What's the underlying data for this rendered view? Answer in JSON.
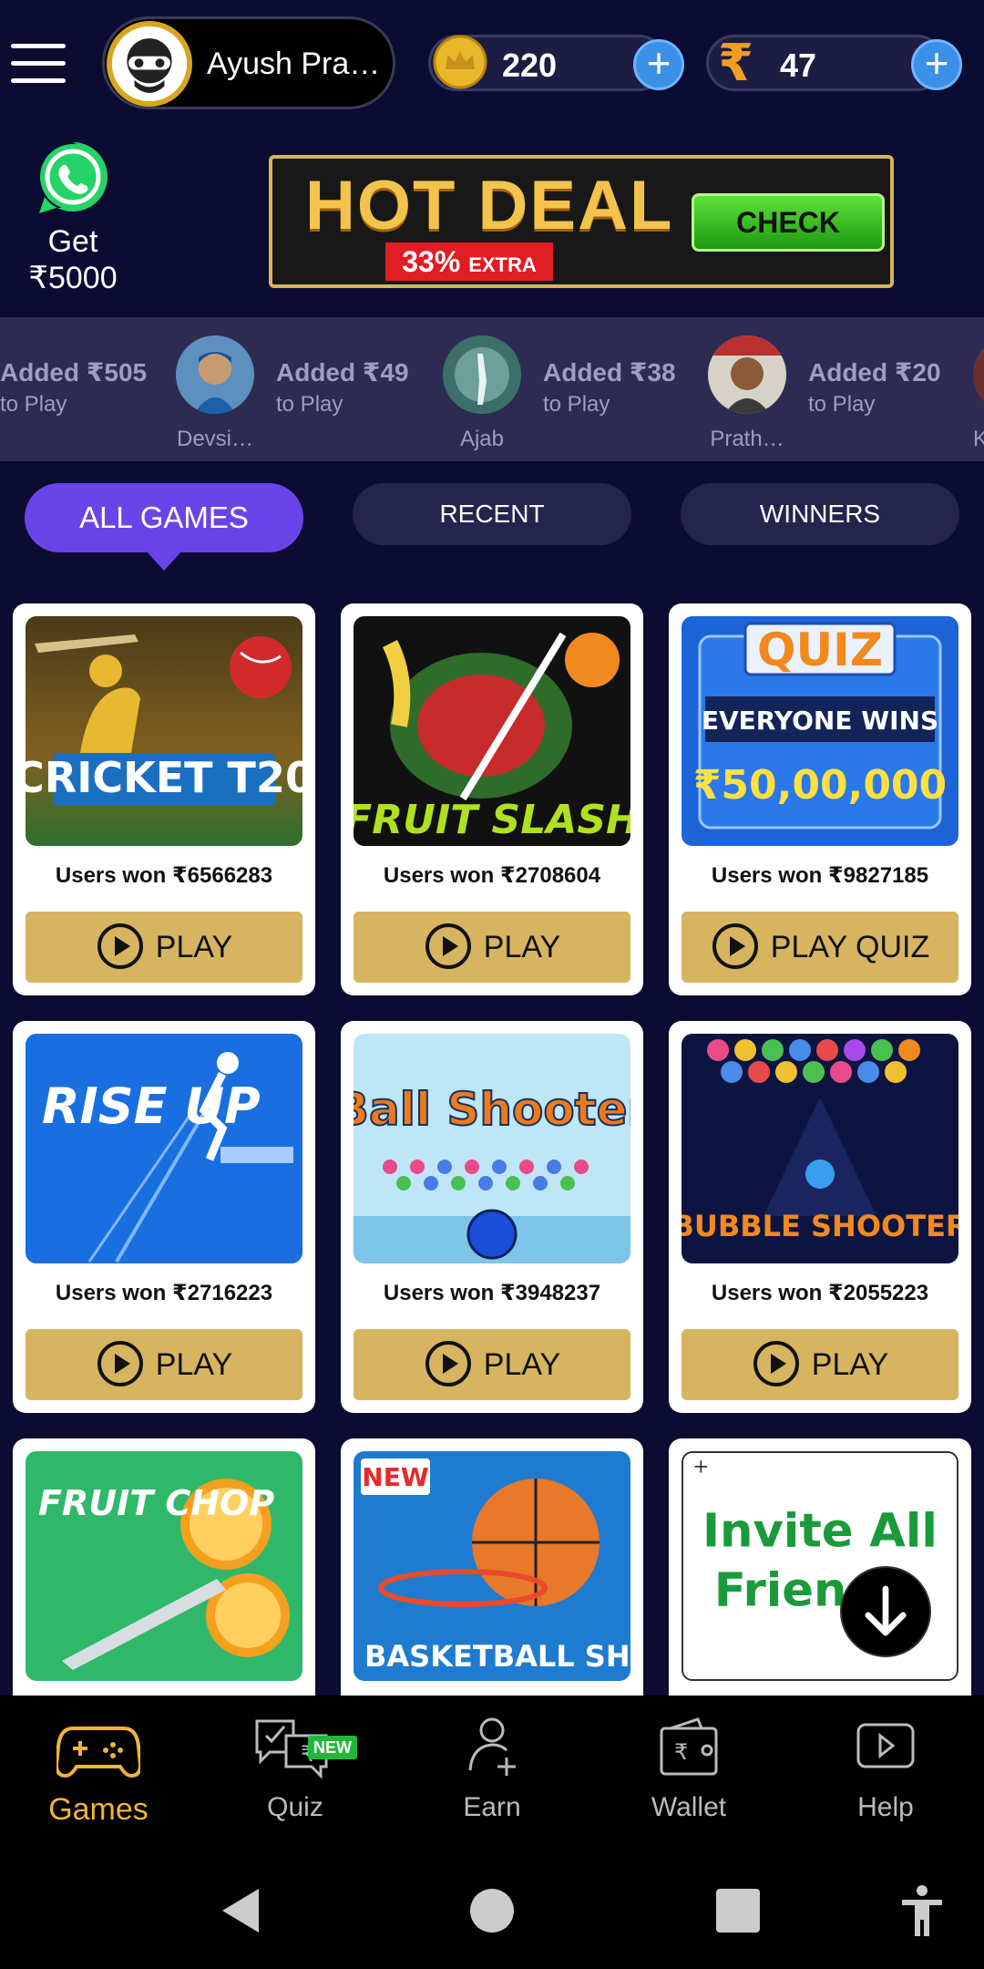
{
  "header": {
    "profile_name": "Ayush Pra…",
    "coins": "220",
    "cash": "47",
    "cash_symbol": "₹"
  },
  "promo": {
    "whatsapp_line1": "Get",
    "whatsapp_line2": "₹5000",
    "hot_deal_title": "HOT DEAL",
    "hot_deal_pct": "33%",
    "hot_deal_extra": "EXTRA",
    "check_label": "CHECK"
  },
  "ticker": [
    {
      "amount": "Added ₹505",
      "sub": "to Play",
      "name": ""
    },
    {
      "amount": "Added ₹49",
      "sub": "to Play",
      "name": "Devsi…"
    },
    {
      "amount": "Added ₹38",
      "sub": "to Play",
      "name": "Ajab"
    },
    {
      "amount": "Added ₹20",
      "sub": "to Play",
      "name": "Prath…"
    },
    {
      "amount": "",
      "sub": "",
      "name": "K"
    }
  ],
  "tabs": [
    {
      "label": "ALL GAMES"
    },
    {
      "label": "RECENT"
    },
    {
      "label": "WINNERS"
    }
  ],
  "games": [
    {
      "title": "CRICKET T20",
      "won": "Users won ₹6566283",
      "button": "PLAY"
    },
    {
      "title": "FRUIT SLASH",
      "won": "Users won ₹2708604",
      "button": "PLAY"
    },
    {
      "title": "QUIZ",
      "won": "Users won ₹9827185",
      "button": "PLAY QUIZ",
      "quiz_sub": "EVERYONE WINS",
      "quiz_prize": "₹50,00,000"
    },
    {
      "title": "RISE UP",
      "won": "Users won ₹2716223",
      "button": "PLAY"
    },
    {
      "title": "Ball Shooter",
      "won": "Users won ₹3948237",
      "button": "PLAY"
    },
    {
      "title": "BUBBLE SHOOTER",
      "won": "Users won ₹2055223",
      "button": "PLAY"
    },
    {
      "title": "FRUIT CHOP"
    },
    {
      "title": "BASKETBALL SHOTS",
      "badge": "NEW"
    },
    {
      "title": "Invite All Friends",
      "title_line1": "Invite All",
      "title_line2": "Frien"
    }
  ],
  "bottom_nav": [
    {
      "label": "Games",
      "icon": "gamepad-icon"
    },
    {
      "label": "Quiz",
      "icon": "quiz-icon",
      "badge": "NEW"
    },
    {
      "label": "Earn",
      "icon": "add-user-icon"
    },
    {
      "label": "Wallet",
      "icon": "wallet-icon"
    },
    {
      "label": "Help",
      "icon": "play-video-icon"
    }
  ],
  "colors": {
    "background": "#0c0c33",
    "active_tab": "#6a44e8",
    "play_button": "#d7b560",
    "active_nav": "#f0b33a"
  }
}
